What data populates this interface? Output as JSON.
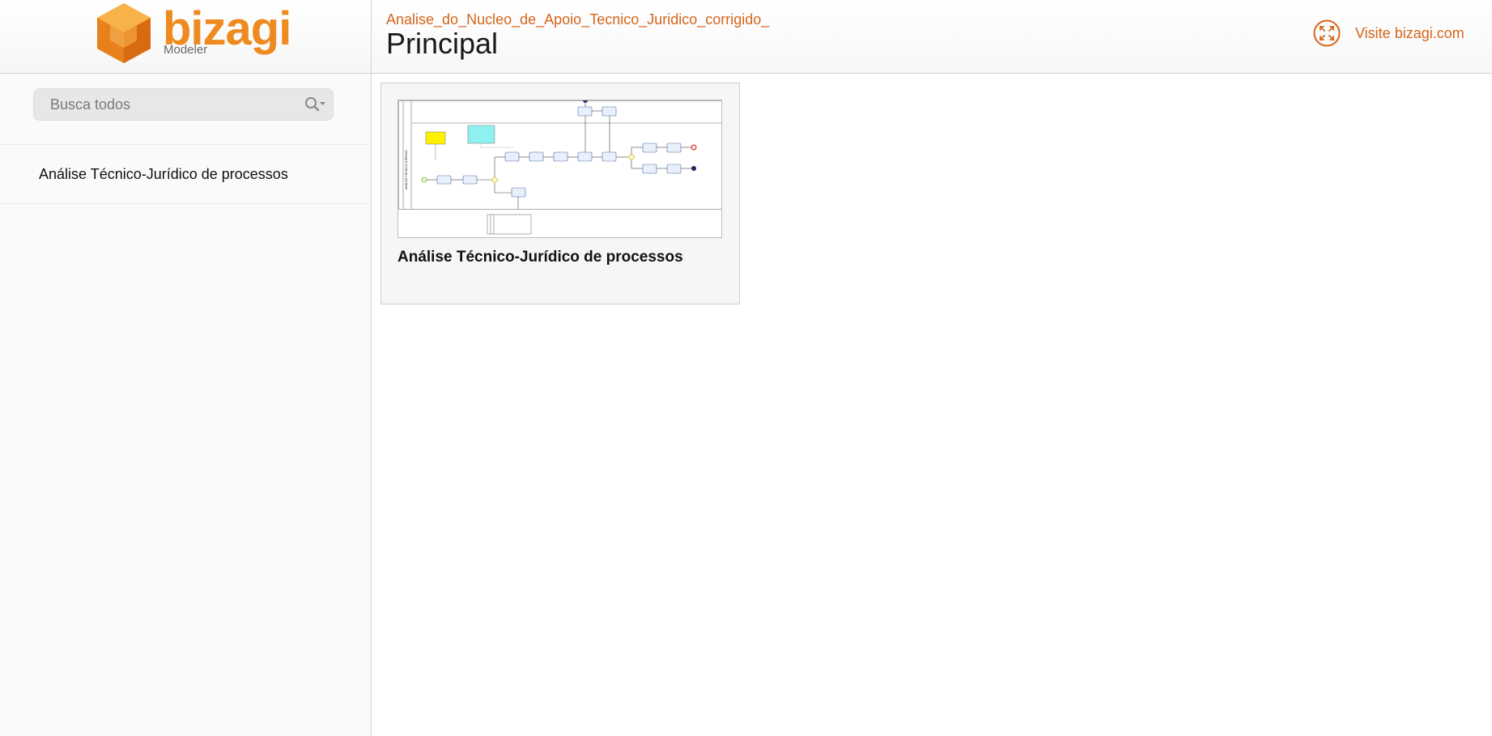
{
  "brand": {
    "name": "bizagi",
    "product": "Modeler",
    "accent_color": "#d4651a",
    "logo_orange": "#ee8a1f"
  },
  "header": {
    "file_name": "Analise_do_Nucleo_de_Apoio_Tecnico_Juridico_corrigido_",
    "page_title": "Principal",
    "visit_link": "Visite bizagi.com",
    "visit_icon": "expand-icon"
  },
  "sidebar": {
    "search": {
      "placeholder": "Busca todos",
      "value": "",
      "icon": "search-icon"
    },
    "items": [
      {
        "label": "Análise Técnico-Jurídico de processos"
      }
    ]
  },
  "main": {
    "cards": [
      {
        "title": "Análise Técnico-Jurídico de processos",
        "thumbnail": "process-diagram-thumbnail"
      }
    ]
  }
}
